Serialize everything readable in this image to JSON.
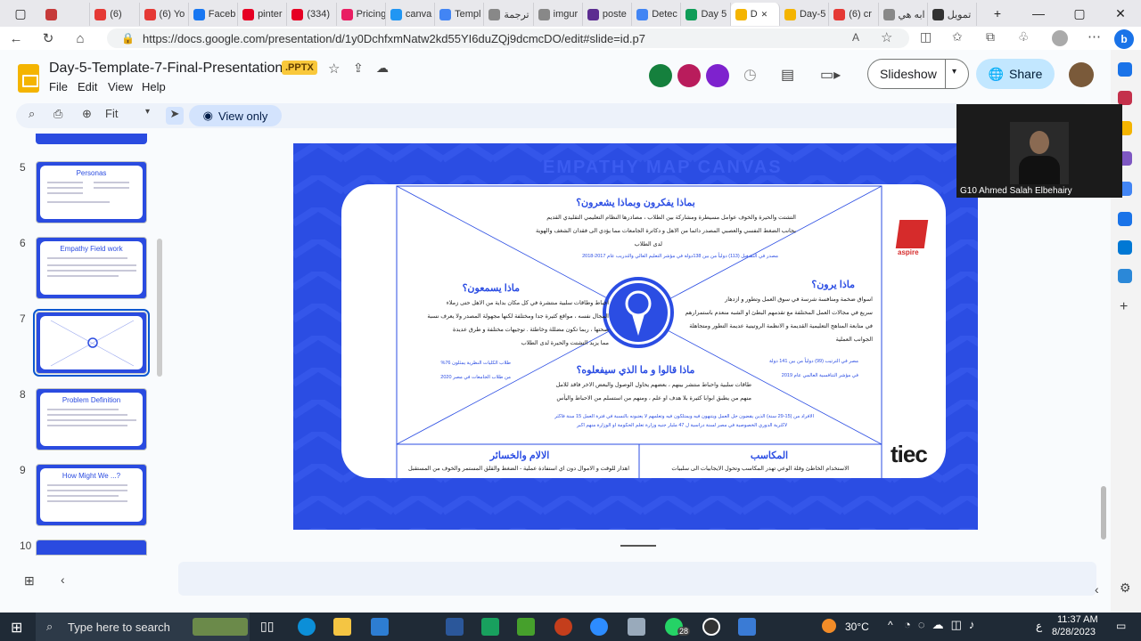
{
  "browser": {
    "tabs": [
      {
        "label": "",
        "color": "#c63a3a"
      },
      {
        "label": "(6)",
        "color": "#e53935"
      },
      {
        "label": "(6) Yo",
        "color": "#e53935"
      },
      {
        "label": "Faceb",
        "color": "#1877f2"
      },
      {
        "label": "pinter",
        "color": "#e60023"
      },
      {
        "label": "(334)",
        "color": "#e60023"
      },
      {
        "label": "Pricing",
        "color": "#e91e63"
      },
      {
        "label": "canva",
        "color": "#2196f3"
      },
      {
        "label": "Templ",
        "color": "#4285f4"
      },
      {
        "label": "ترجمة",
        "color": "#888888"
      },
      {
        "label": "imgur",
        "color": "#888888"
      },
      {
        "label": "poste",
        "color": "#5c2d91"
      },
      {
        "label": "Detec",
        "color": "#4285f4"
      },
      {
        "label": "Day 5",
        "color": "#0f9d58"
      },
      {
        "label": "D",
        "color": "#f4b400",
        "active": true
      },
      {
        "label": "Day-5",
        "color": "#f4b400"
      },
      {
        "label": "(6) cr",
        "color": "#e53935"
      },
      {
        "label": "ابه هي",
        "color": "#888888"
      },
      {
        "label": "تمويل",
        "color": "#333333"
      }
    ],
    "url": "https://docs.google.com/presentation/d/1y0DchfxmNatw2kd55YI6duZQj9dcmcDO/edit#slide=id.p7"
  },
  "doc": {
    "title": "Day-5-Template-7-Final-Presentation",
    "badge": ".PPTX",
    "menus": [
      "File",
      "Edit",
      "View",
      "Help"
    ],
    "zoom": "Fit",
    "view_only": "View only",
    "slideshow": "Slideshow",
    "share": "Share"
  },
  "filmstrip": [
    {
      "num": "5",
      "title": "Personas"
    },
    {
      "num": "6",
      "title": "Empathy Field work"
    },
    {
      "num": "7",
      "title": "",
      "selected": true
    },
    {
      "num": "8",
      "title": "Problem Definition"
    },
    {
      "num": "9",
      "title": "How Might We ...?"
    },
    {
      "num": "10",
      "title": ""
    }
  ],
  "slide": {
    "heading_top": "بماذا يفكرون وبماذا يشعرون؟",
    "text_top_1": "التشتت والحيرة والخوف عوامل مسيطرة ومشاركة بين الطلاب ، مصادرها النظام التعليمي التقليدي القديم",
    "text_top_2": "بجانب الضغط النفسي والعصبي المصدر دائما من الاهل و دكاترة الجامعات مما يؤدي الى فقدان الشغف والهوية",
    "text_top_3": "لدى الطلاب",
    "src_top": "مصدر في التشغيل (113) دولياً من بين 138دولة في مؤشر التعليم العالي والتدريب عام 2017-2018",
    "heading_left": "ماذا يسمعون؟",
    "text_left_1": "احباط وطاقات سلبية منتشرة في كل مكان بداية من الاهل حتى زملاء",
    "text_left_2": "المجال نفسه ، مواقع كثيرة جدا ومختلفة لكنها مجهولة المصدر ولا يعرف نسبة",
    "text_left_3": "صحتها ، ربما تكون مضللة وخاطئة . توجيهات مختلفة و طرق عديدة",
    "text_left_4": "مما يزيد التشتت والحيرة لدى الطلاب",
    "src_left_1": "طلاب الكليات النظرية يمثلون 76%",
    "src_left_2": "من طلاب الجامعات في مصر 2020",
    "heading_right": "ماذا يرون؟",
    "text_right_1": "اسواق ضخمة ومنافسة شرسة في سوق العمل وتطور و ازدهار",
    "text_right_2": "سريع في مجالات العمل المختلفة مع تقدمهم البطئ او الشبه منعدم باستمرارهم",
    "text_right_3": "في متابعة المناهج التعليمية القديمة و الانظمة الروتينية عديمة التطور ومتجاهلة",
    "text_right_4": "الجوانب العملية",
    "src_right_1": "مصر في الترتيب (99) دولياً من بين 141 دولة",
    "src_right_2": "في مؤشر التنافسية العالمي عام 2019",
    "heading_bottom": "ماذا قالوا و ما الذي سيفعلوه؟",
    "text_bottom_1": "طاقات سلبية واحباط منتشر بينهم ، بعضهم يحاول الوصول والبعض الاخر فاقد للامل",
    "text_bottom_2": "منهم من يطبق ابوابا كثيرة بلا هدف او علم ، ومنهم من استسلم من الاحباط واليأس",
    "src_bottom_1": "الافراد من (15-29 سنة) الذين يقضون جل العمل ويتنهون فيه ويمتلكون فيه وتعلمهم لا يعتبونه بالنسبة في فترة العمل 15 سنة فأكثر",
    "src_bottom_2": "لاكثرية الدوري الخصوصية في مصر لسنة دراسية ل 47 مليار جنيه وزارة تعلم الحكومة أو الوزارة منهم أكبر",
    "gains_title": "المكاسب",
    "gains_text": "الاستخدام الخاطئ وقلة الوعي تهدر المكاسب وتحول الايجابيات الى سلبيات",
    "pains_title": "الالام والخسائر",
    "pains_text": "اهدار للوقت و الاموال دون اي استفادة عملية - الضغط والقلق المستمر والخوف من المستقبل",
    "faint_title": "EMPATHY MAP CANVAS",
    "logo_aspire": "aspire",
    "logo_tiec": "tiec"
  },
  "camera": {
    "name": "G10 Ahmed Salah Elbehairy"
  },
  "taskbar": {
    "search_placeholder": "Type here to search",
    "weather": "30°C",
    "time": "11:37 AM",
    "date": "8/28/2023",
    "lang": "ع",
    "badge": "28"
  },
  "colors": {
    "accent": "#2b4de3",
    "docs_yellow": "#f4b400"
  }
}
